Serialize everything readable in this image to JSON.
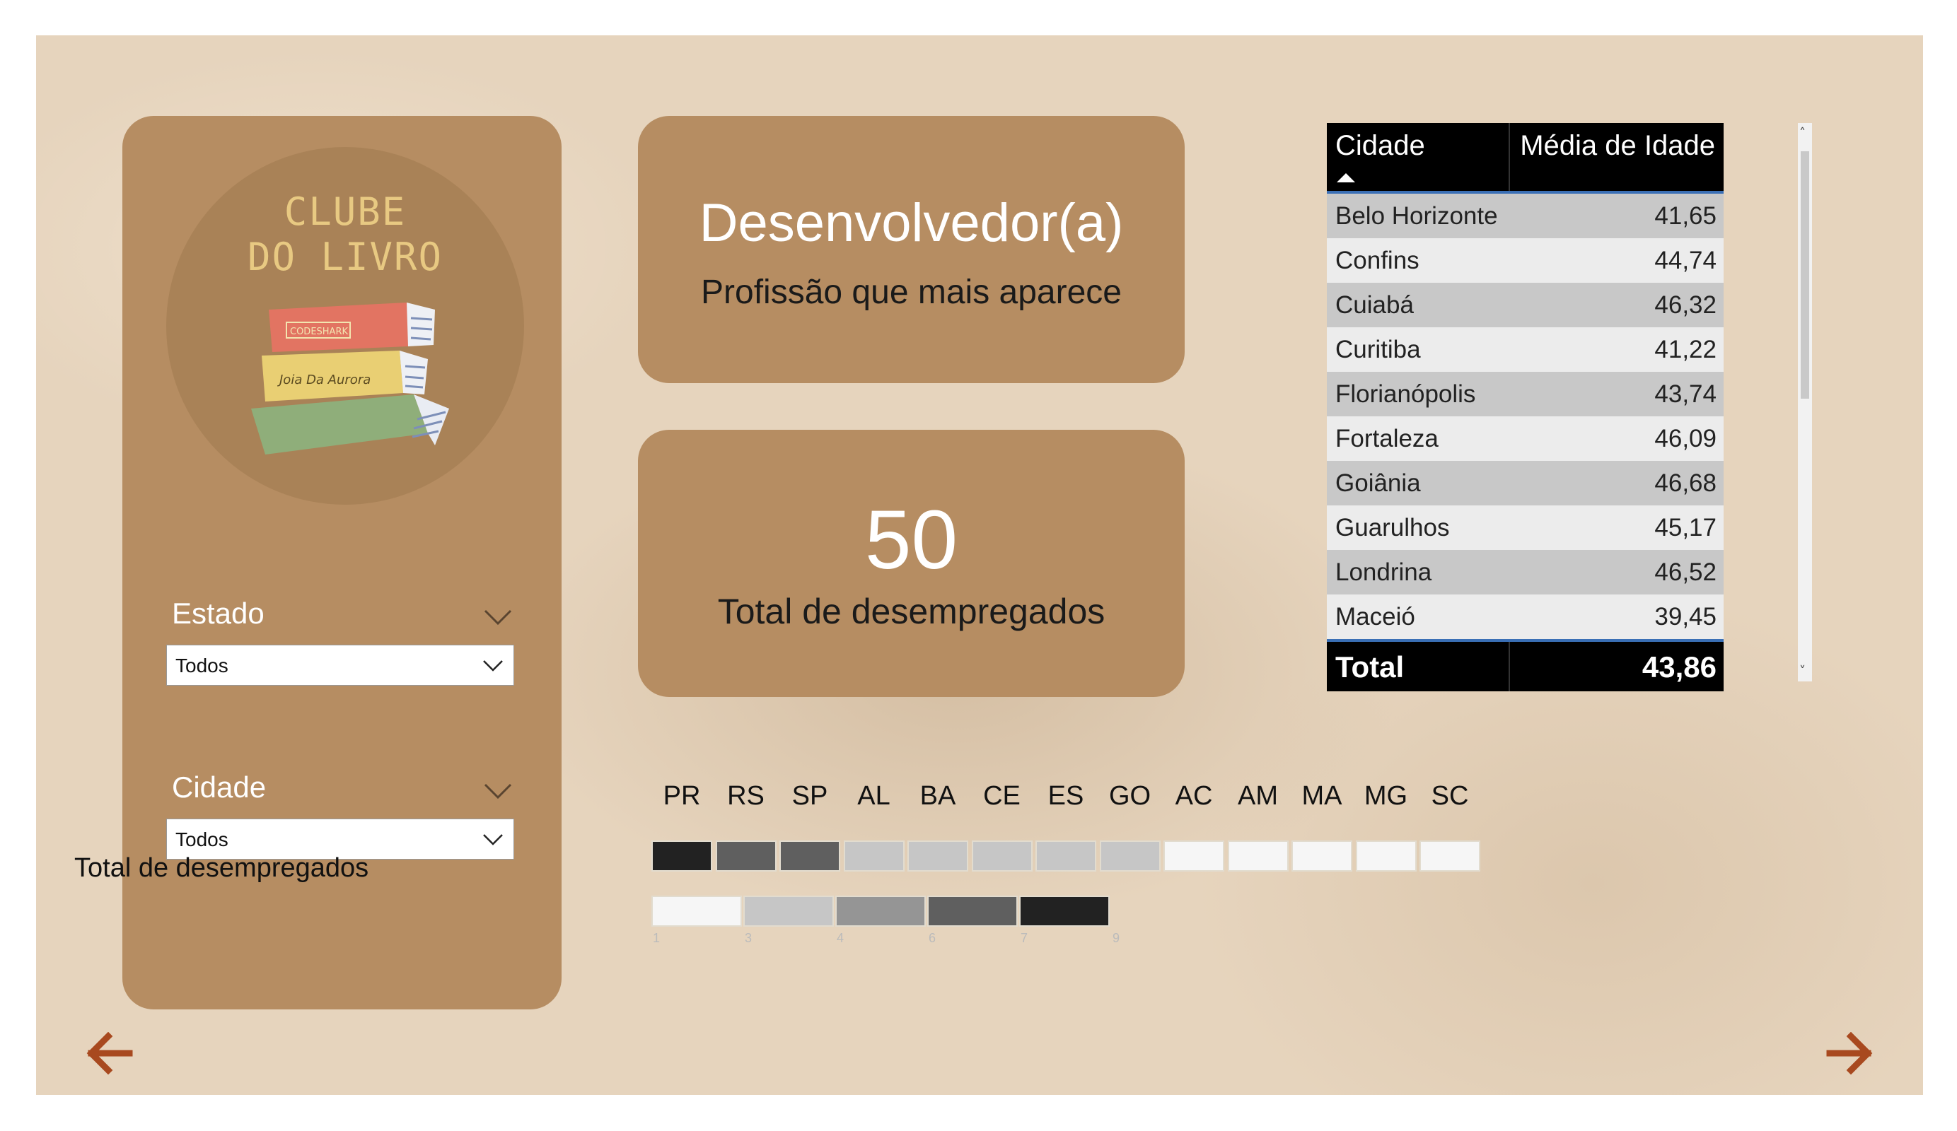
{
  "logo": {
    "line1": "CLUBE",
    "line2": "DO LIVRO",
    "book_spine_1": "CODESHARK",
    "book_spine_2": "Joia Da Aurora"
  },
  "slicers": [
    {
      "title": "Estado",
      "value": "Todos"
    },
    {
      "title": "Cidade",
      "value": "Todos"
    }
  ],
  "kpi_profession": {
    "value": "Desenvolvedor(a)",
    "label": "Profissão que mais aparece"
  },
  "kpi_unemployed": {
    "value": "50",
    "label": "Total de desempregados"
  },
  "table": {
    "col1": "Cidade",
    "col2": "Média de Idade",
    "rows": [
      {
        "city": "Belo Horizonte",
        "age": "41,65"
      },
      {
        "city": "Confins",
        "age": "44,74"
      },
      {
        "city": "Cuiabá",
        "age": "46,32"
      },
      {
        "city": "Curitiba",
        "age": "41,22"
      },
      {
        "city": "Florianópolis",
        "age": "43,74"
      },
      {
        "city": "Fortaleza",
        "age": "46,09"
      },
      {
        "city": "Goiânia",
        "age": "46,68"
      },
      {
        "city": "Guarulhos",
        "age": "45,17"
      },
      {
        "city": "Londrina",
        "age": "46,52"
      },
      {
        "city": "Maceió",
        "age": "39,45"
      }
    ],
    "total_label": "Total",
    "total_value": "43,86"
  },
  "matrix": {
    "row_label": "Total de desempregados",
    "states": [
      "PR",
      "RS",
      "SP",
      "AL",
      "BA",
      "CE",
      "ES",
      "GO",
      "AC",
      "AM",
      "MA",
      "MG",
      "SC"
    ],
    "colors": [
      "#222222",
      "#5f5f5f",
      "#5f5f5f",
      "#c6c6c6",
      "#c6c6c6",
      "#c6c6c6",
      "#c6c6c6",
      "#c6c6c6",
      "#f6f6f6",
      "#f6f6f6",
      "#f6f6f6",
      "#f6f6f6",
      "#f6f6f6"
    ],
    "legend_colors": [
      "#f6f6f6",
      "#c6c6c6",
      "#959595",
      "#5f5f5f",
      "#222222"
    ],
    "legend_ticks": [
      "1",
      "3",
      "4",
      "6",
      "7",
      "9"
    ]
  },
  "nav": {
    "accent_color": "#a8491f"
  }
}
